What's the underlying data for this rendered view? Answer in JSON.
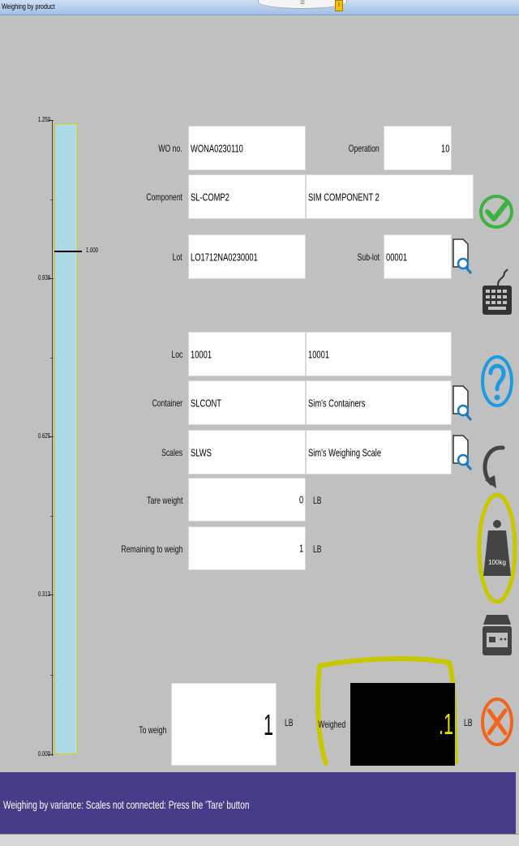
{
  "window": {
    "title": "Weighing by product",
    "handle_glyph": "≡",
    "tag_glyph": "!"
  },
  "gauge": {
    "ticks": [
      {
        "label": "1.250",
        "value": 1.25
      },
      {
        "label": "0.938",
        "value": 0.938
      },
      {
        "label": "0.625",
        "value": 0.625
      },
      {
        "label": "0.313",
        "value": 0.313
      },
      {
        "label": "0.000",
        "value": 0
      }
    ],
    "target_label": "1.000",
    "target_value": 1.0
  },
  "form": {
    "wo_label": "WO no.",
    "wo_value": "WONA0230110",
    "operation_label": "Operation",
    "operation_value": "10",
    "component_label": "Component",
    "component_code": "SL-COMP2",
    "component_desc": "SIM COMPONENT 2",
    "lot_label": "Lot",
    "lot_value": "LO1712NA0230001",
    "sublot_label": "Sub-lot",
    "sublot_value": "00001",
    "loc_label": "Loc",
    "loc_code": "10001",
    "loc_desc": "10001",
    "container_label": "Container",
    "container_code": "SLCONT",
    "container_desc": "Sim's Containers",
    "scales_label": "Scales",
    "scales_code": "SLWS",
    "scales_desc": "Sim's Weighing Scale",
    "tare_label": "Tare weight",
    "tare_value": "0",
    "tare_unit": "LB",
    "remaining_label": "Remaining to weigh",
    "remaining_value": "1",
    "remaining_unit": "LB",
    "toweigh_label": "To weigh",
    "toweigh_value": "1",
    "toweigh_unit": "LB",
    "weighed_label": "Weighed",
    "weighed_value": ".1",
    "weighed_unit": "LB"
  },
  "buttons": {
    "weight_text": "100kg"
  },
  "status": {
    "message": "Weighing  by variance: Scales not connected:  Press the 'Tare' button"
  },
  "colors": {
    "gauge_fill": "#add8e6",
    "status_bg": "#463c88",
    "ok_green": "#3cb33c",
    "help_blue": "#1e9be0",
    "cancel_orange": "#f0641e",
    "highlight": "#c8c800",
    "display_digits": "#f2e000"
  }
}
